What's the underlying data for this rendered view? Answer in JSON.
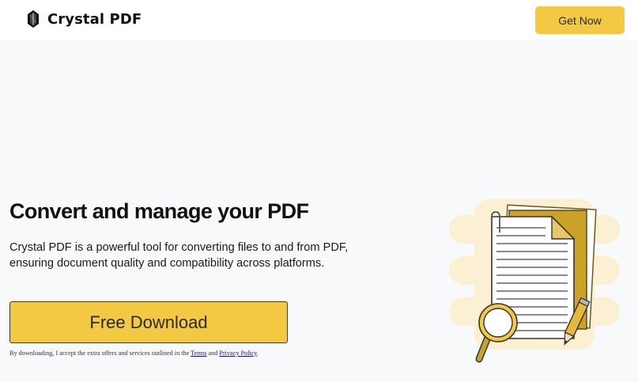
{
  "header": {
    "brand_name": "Crystal PDF",
    "brand_icon": "crystal-logo-icon",
    "cta_label": "Get Now"
  },
  "hero": {
    "title": "Convert and manage your PDF",
    "description": "Crystal PDF is a powerful tool for converting files to and from PDF, ensuring document quality and compatibility across platforms.",
    "download_label": "Free Download",
    "disclaimer_prefix": "By downloading, I accept the extra offers and services outlined in the",
    "terms_label": "Terms",
    "and_text": "and",
    "privacy_label": "Privacy Policy",
    "disclaimer_suffix": "."
  },
  "illustration": {
    "icon": "documents-with-magnifier-and-pencil-illustration"
  },
  "colors": {
    "accent": "#f3c843",
    "background": "#f8f9fb",
    "header_bg": "#ffffff",
    "illustration_blob": "#fbf0d1",
    "folder": "#c9a227"
  }
}
